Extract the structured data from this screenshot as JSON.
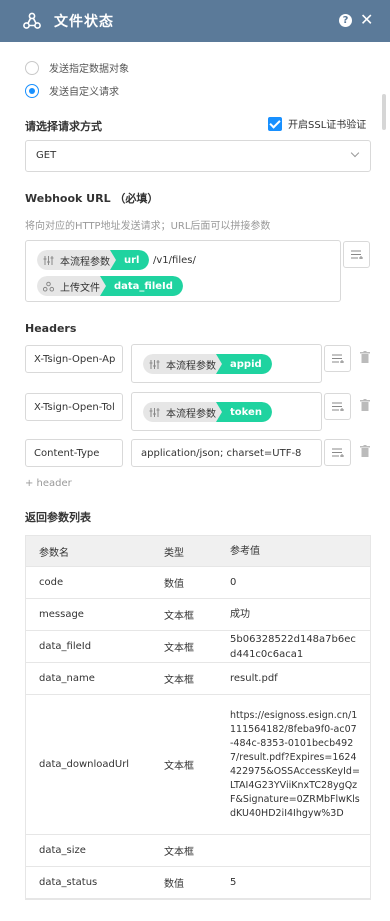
{
  "header": {
    "title": "文件状态",
    "help_label": "?",
    "close_label": "✕"
  },
  "radios": [
    {
      "label": "发送指定数据对象",
      "selected": false
    },
    {
      "label": "发送自定义请求",
      "selected": true
    }
  ],
  "request_method": {
    "label": "请选择请求方式",
    "ssl_label": "开启SSL证书验证",
    "ssl_checked": true,
    "value": "GET"
  },
  "webhook": {
    "label": "Webhook URL （必填）",
    "hint": "将向对应的HTTP地址发送请求；URL后面可以拼接参数",
    "chip1_label": "本流程参数",
    "chip1_value": "url",
    "url_suffix": "/v1/files/",
    "chip2_label": "上传文件",
    "chip2_value": "data_fileId"
  },
  "headers": {
    "label": "Headers",
    "rows": [
      {
        "key": "X-Tsign-Open-Ap",
        "chip_label": "本流程参数",
        "chip_value": "appid"
      },
      {
        "key": "X-Tsign-Open-Tol",
        "chip_label": "本流程参数",
        "chip_value": "token"
      },
      {
        "key": "Content-Type",
        "value": "application/json; charset=UTF-8"
      }
    ],
    "add_label": "+ header"
  },
  "return_params": {
    "label": "返回参数列表",
    "columns": [
      "参数名",
      "类型",
      "参考值"
    ],
    "rows": [
      {
        "name": "code",
        "type": "数值",
        "value": "0"
      },
      {
        "name": "message",
        "type": "文本框",
        "value": "成功"
      },
      {
        "name": "data_fileId",
        "type": "文本框",
        "value": "5b06328522d148a7b6ecd441c0c6aca1"
      },
      {
        "name": "data_name",
        "type": "文本框",
        "value": "result.pdf"
      },
      {
        "name": "data_downloadUrl",
        "type": "文本框",
        "value": "https://esignoss.esign.cn/1111564182/8feba9f0-ac07-484c-8353-0101becb4927/result.pdf?Expires=1624422975&OSSAccessKeyId=LTAI4G23YViiKnxTC28ygQzF&Signature=0ZRMbFlwKlsdKU40HD2iI4Ihgyw%3D"
      },
      {
        "name": "data_size",
        "type": "文本框",
        "value": ""
      },
      {
        "name": "data_status",
        "type": "数值",
        "value": "5"
      }
    ]
  },
  "colors": {
    "header_bg": "#5b7a99",
    "accent": "#1890ff",
    "chip_green": "#1fd3a0"
  }
}
